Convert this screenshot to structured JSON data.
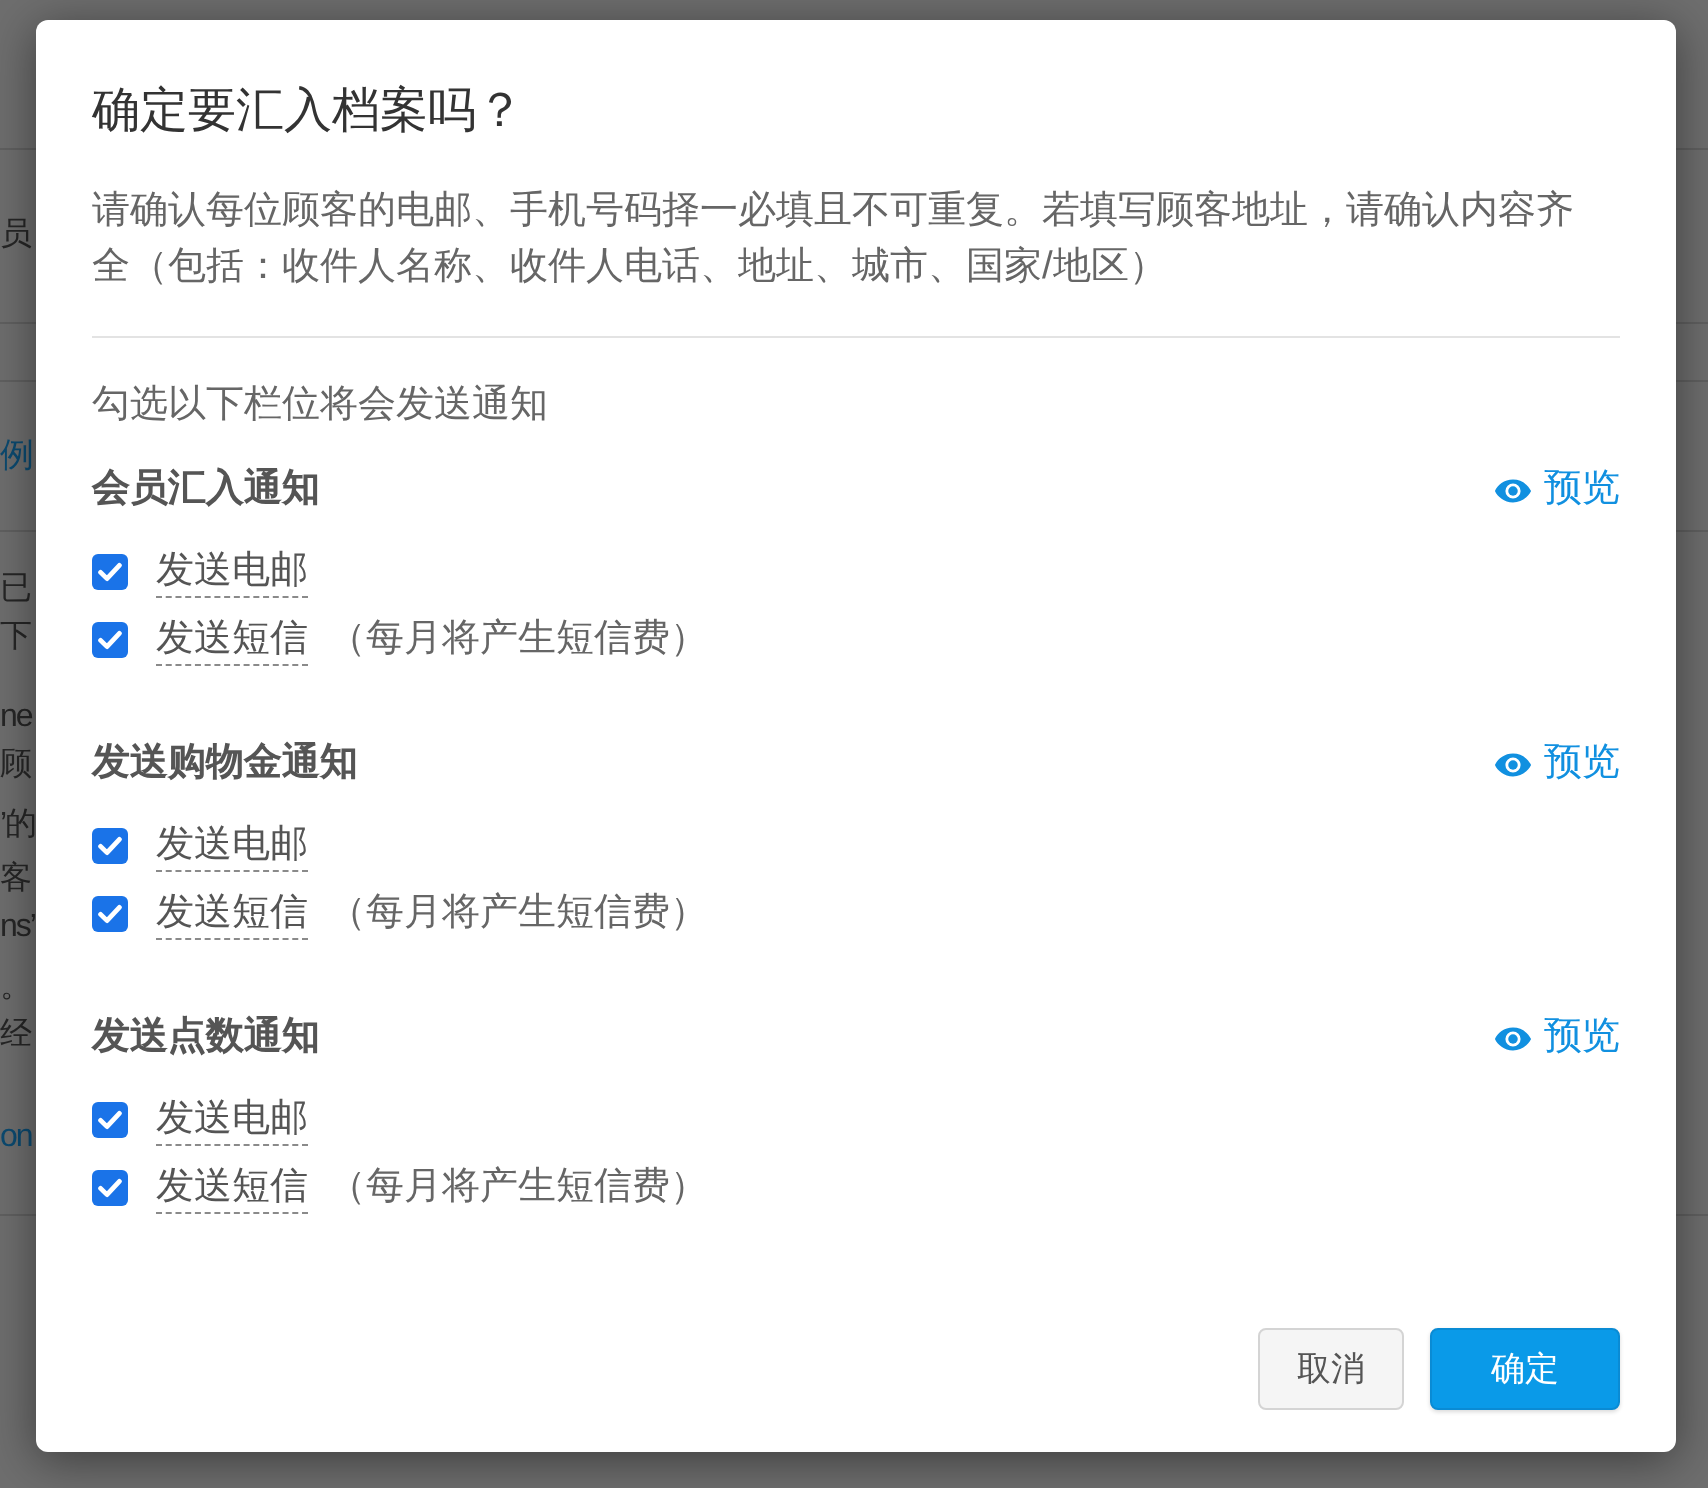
{
  "background_page": {
    "row_text": "员",
    "card_title": "例",
    "card_lines": [
      {
        "text": "已",
        "kind": "text"
      },
      {
        "text": "下",
        "kind": "text"
      },
      {
        "text": "ne",
        "kind": "text"
      },
      {
        "text": "顾",
        "kind": "text"
      },
      {
        "text": "’的",
        "kind": "text"
      },
      {
        "text": "客",
        "kind": "text"
      },
      {
        "text": "ns’",
        "kind": "text"
      },
      {
        "text": "。",
        "kind": "text"
      },
      {
        "text": "经",
        "kind": "text"
      },
      {
        "text": "on",
        "kind": "link"
      }
    ]
  },
  "dialog": {
    "title": "确定要汇入档案吗？",
    "description": "请确认每位顾客的电邮、手机号码择一必填且不可重复。若填写顾客地址，请确认内容齐全（包括：收件人名称、收件人电话、地址、城市、国家/地区）",
    "notify_hint": "勾选以下栏位将会发送通知",
    "sections": [
      {
        "title": "会员汇入通知",
        "preview_link": "预览",
        "options": [
          {
            "label": "发送电邮",
            "checked": true
          },
          {
            "label": "发送短信",
            "checked": true,
            "note": "（每月将产生短信费）"
          }
        ]
      },
      {
        "title": "发送购物金通知",
        "preview_link": "预览",
        "options": [
          {
            "label": "发送电邮",
            "checked": true
          },
          {
            "label": "发送短信",
            "checked": true,
            "note": "（每月将产生短信费）"
          }
        ]
      },
      {
        "title": "发送点数通知",
        "preview_link": "预览",
        "options": [
          {
            "label": "发送电邮",
            "checked": true
          },
          {
            "label": "发送短信",
            "checked": true,
            "note": "（每月将产生短信费）"
          }
        ]
      }
    ],
    "buttons": [
      {
        "label": "取消",
        "kind": "secondary"
      },
      {
        "label": "确定",
        "kind": "primary"
      }
    ]
  }
}
